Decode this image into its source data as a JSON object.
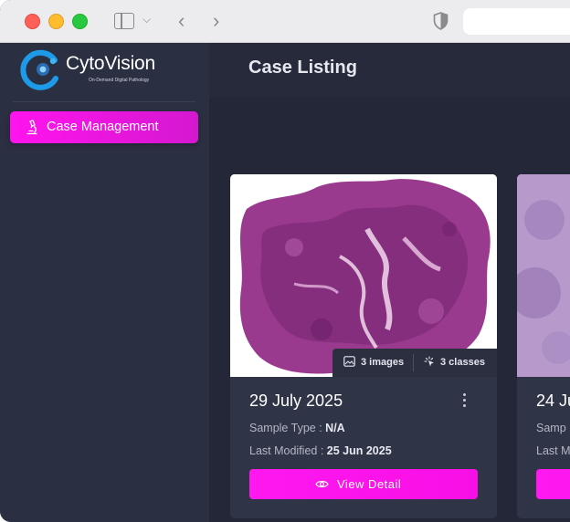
{
  "app": {
    "name": "CytoVision",
    "tagline": "On-Demand Digital Pathology"
  },
  "sidebar": {
    "items": [
      {
        "label": "Case Management",
        "icon": "microscope-icon",
        "active": true
      }
    ]
  },
  "header": {
    "title": "Case Listing"
  },
  "cards": [
    {
      "date": "29 July 2025",
      "images_count": "3 images",
      "classes_count": "3 classes",
      "sample_type_label": "Sample Type :",
      "sample_type_value": "N/A",
      "last_modified_label": "Last Modified :",
      "last_modified_value": "25 Jun 2025",
      "button_label": "View Detail"
    },
    {
      "date": "24 Ju",
      "sample_type_label": "Samp",
      "last_modified_label": "Last M"
    }
  ],
  "colors": {
    "accent": "#ff14ee",
    "sidebar_bg": "#2b2f42",
    "main_bg": "#232738",
    "card_bg": "#2f3447"
  }
}
